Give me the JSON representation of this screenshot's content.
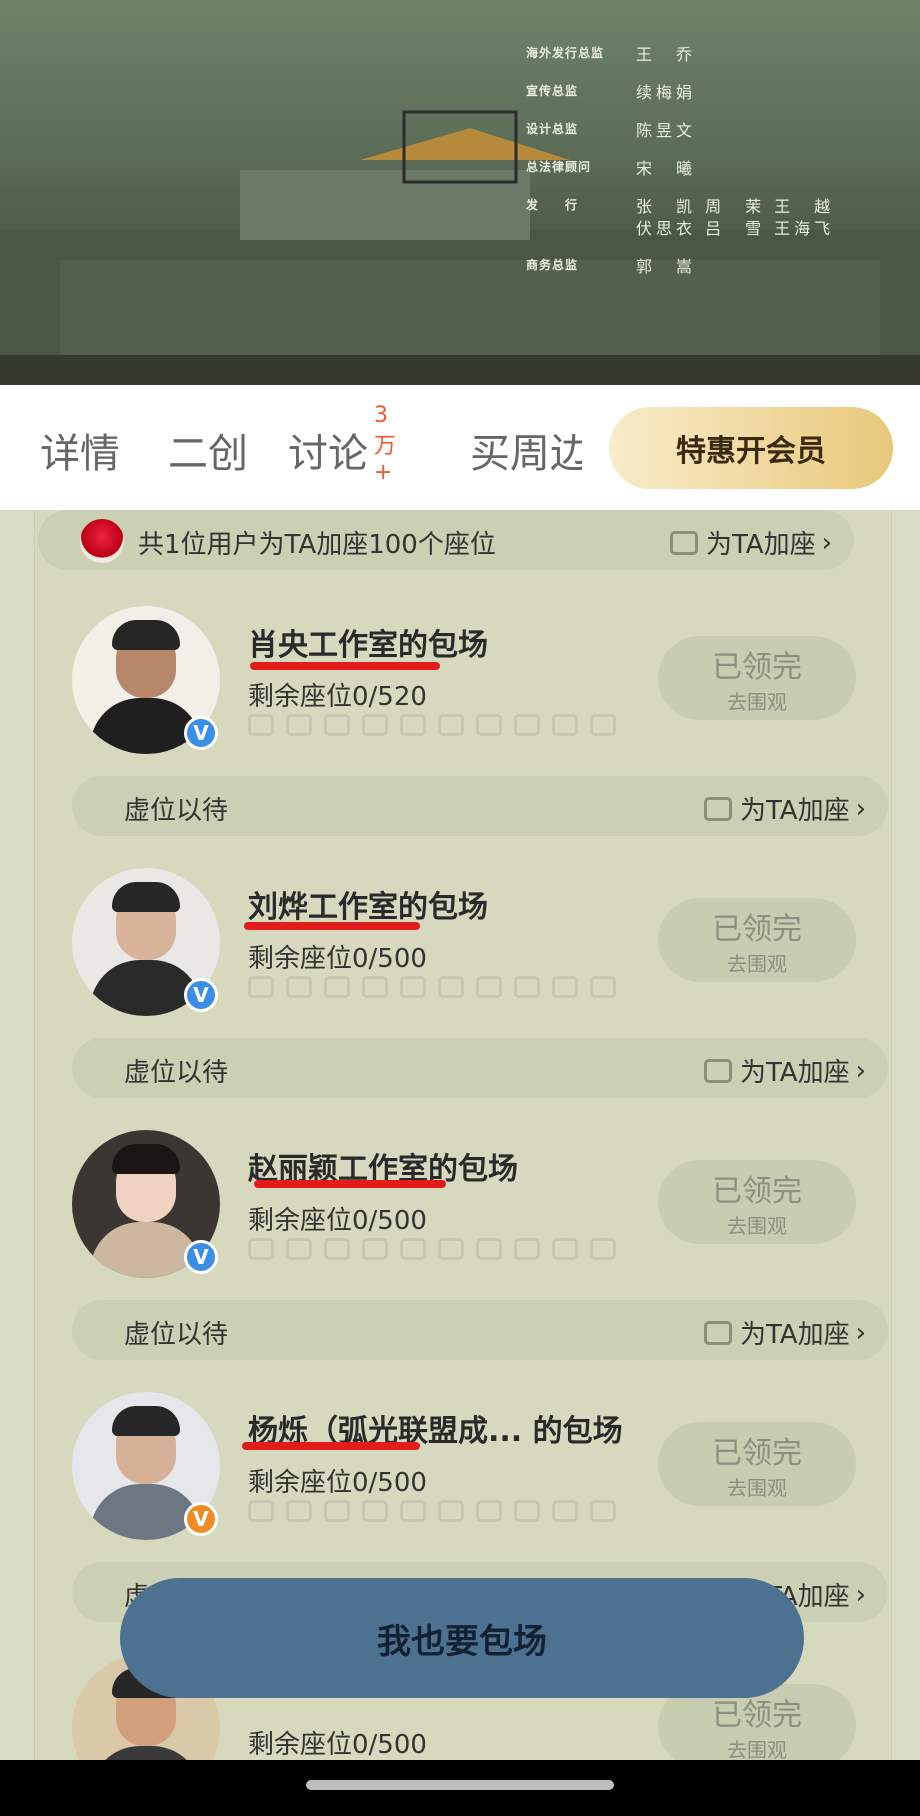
{
  "banner": {
    "credits": [
      {
        "role": "海外发行总监",
        "name": "王　乔"
      },
      {
        "role": "宣传总监",
        "name": "续梅娟"
      },
      {
        "role": "设计总监",
        "name": "陈昱文"
      },
      {
        "role": "总法律顾问",
        "name": "宋　曦"
      },
      {
        "role": "发　　行",
        "name": "张　凯 周　茉 王　越\n伏思衣 吕　雪 王海飞"
      },
      {
        "role": "商务总监",
        "name": "郭　嵩"
      }
    ]
  },
  "tabs": [
    {
      "label": "详情"
    },
    {
      "label": "二创"
    },
    {
      "label": "讨论",
      "badge": "3万+"
    },
    {
      "label": "买周边"
    }
  ],
  "vip_button": "特惠开会员",
  "summary": {
    "text": "共1位用户为TA加座100个座位",
    "action": "为TA加座"
  },
  "cards": [
    {
      "title": "肖央工作室的包场",
      "remaining": "剩余座位0/520",
      "status": "已领完",
      "sub": "去围观",
      "wait": "虚位以待",
      "action": "为TA加座",
      "badge_color": "#3b8ee6"
    },
    {
      "title": "刘烨工作室的包场",
      "remaining": "剩余座位0/500",
      "status": "已领完",
      "sub": "去围观",
      "wait": "虚位以待",
      "action": "为TA加座",
      "badge_color": "#3b8ee6"
    },
    {
      "title": "赵丽颖工作室的包场",
      "remaining": "剩余座位0/500",
      "status": "已领完",
      "sub": "去围观",
      "wait": "虚位以待",
      "action": "为TA加座",
      "badge_color": "#3b8ee6"
    },
    {
      "title": "杨烁（弧光联盟成... 的包场",
      "remaining": "剩余座位0/500",
      "status": "已领完",
      "sub": "去围观",
      "wait": "虚位以待",
      "action": "为TA加座",
      "badge_color": "#f08a24"
    },
    {
      "title": "",
      "remaining": "剩余座位0/500",
      "status": "已领完",
      "sub": "去围观"
    }
  ],
  "cta": "我也要包场",
  "badge_glyph": "V",
  "chevron": "›"
}
